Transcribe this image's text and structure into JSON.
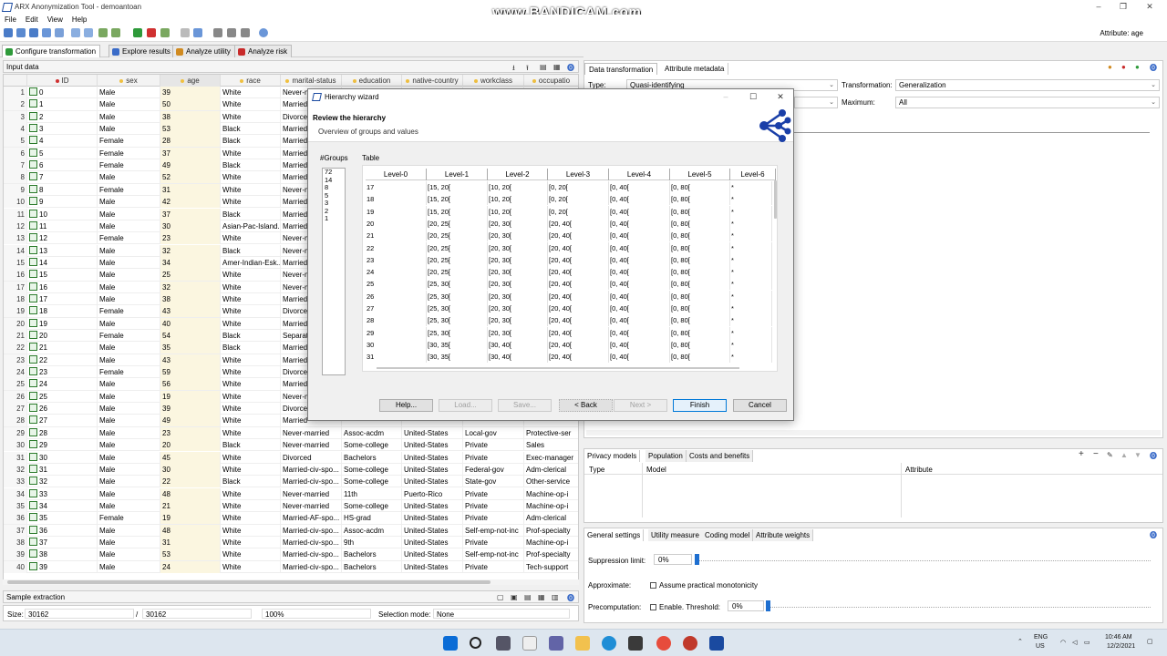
{
  "app": {
    "title": "ARX Anonymization Tool - demoantoan",
    "watermark": "www.BANDICAM.com",
    "attribute_label": "Attribute: age"
  },
  "menu": [
    "File",
    "Edit",
    "View",
    "Help"
  ],
  "perspectives": [
    {
      "label": "Configure transformation",
      "color": "#2e9a3a"
    },
    {
      "label": "Explore results",
      "color": "#3a6bc8"
    },
    {
      "label": "Analyze utility",
      "color": "#d08a20"
    },
    {
      "label": "Analyze risk",
      "color": "#c82a2a"
    }
  ],
  "input": {
    "title": "Input data",
    "columns": [
      "ID",
      "sex",
      "age",
      "race",
      "marital-status",
      "education",
      "native-country",
      "workclass",
      "occupatio"
    ],
    "rows": [
      [
        "0",
        "Male",
        "39",
        "White",
        "Never-m",
        "",
        "",
        "",
        ""
      ],
      [
        "1",
        "Male",
        "50",
        "White",
        "Married",
        "",
        "",
        "",
        ""
      ],
      [
        "2",
        "Male",
        "38",
        "White",
        "Divorce",
        "",
        "",
        "",
        ""
      ],
      [
        "3",
        "Male",
        "53",
        "Black",
        "Married",
        "",
        "",
        "",
        ""
      ],
      [
        "4",
        "Female",
        "28",
        "Black",
        "Married",
        "",
        "",
        "",
        ""
      ],
      [
        "5",
        "Female",
        "37",
        "White",
        "Married",
        "",
        "",
        "",
        ""
      ],
      [
        "6",
        "Female",
        "49",
        "Black",
        "Married",
        "",
        "",
        "",
        ""
      ],
      [
        "7",
        "Male",
        "52",
        "White",
        "Married",
        "",
        "",
        "",
        ""
      ],
      [
        "8",
        "Female",
        "31",
        "White",
        "Never-m",
        "",
        "",
        "",
        ""
      ],
      [
        "9",
        "Male",
        "42",
        "White",
        "Married",
        "",
        "",
        "",
        ""
      ],
      [
        "10",
        "Male",
        "37",
        "Black",
        "Married",
        "",
        "",
        "",
        ""
      ],
      [
        "11",
        "Male",
        "30",
        "Asian-Pac-Island...",
        "Married",
        "",
        "",
        "",
        ""
      ],
      [
        "12",
        "Female",
        "23",
        "White",
        "Never-m",
        "",
        "",
        "",
        ""
      ],
      [
        "13",
        "Male",
        "32",
        "Black",
        "Never-m",
        "",
        "",
        "",
        ""
      ],
      [
        "14",
        "Male",
        "34",
        "Amer-Indian-Esk...",
        "Married",
        "",
        "",
        "",
        ""
      ],
      [
        "15",
        "Male",
        "25",
        "White",
        "Never-m",
        "",
        "",
        "",
        ""
      ],
      [
        "16",
        "Male",
        "32",
        "White",
        "Never-m",
        "",
        "",
        "",
        ""
      ],
      [
        "17",
        "Male",
        "38",
        "White",
        "Married",
        "",
        "",
        "",
        ""
      ],
      [
        "18",
        "Female",
        "43",
        "White",
        "Divorce",
        "",
        "",
        "",
        ""
      ],
      [
        "19",
        "Male",
        "40",
        "White",
        "Married",
        "",
        "",
        "",
        ""
      ],
      [
        "20",
        "Female",
        "54",
        "Black",
        "Separat",
        "",
        "",
        "",
        ""
      ],
      [
        "21",
        "Male",
        "35",
        "Black",
        "Married",
        "",
        "",
        "",
        ""
      ],
      [
        "22",
        "Male",
        "43",
        "White",
        "Married",
        "",
        "",
        "",
        ""
      ],
      [
        "23",
        "Female",
        "59",
        "White",
        "Divorce",
        "",
        "",
        "",
        ""
      ],
      [
        "24",
        "Male",
        "56",
        "White",
        "Married",
        "",
        "",
        "",
        ""
      ],
      [
        "25",
        "Male",
        "19",
        "White",
        "Never-m",
        "",
        "",
        "",
        ""
      ],
      [
        "26",
        "Male",
        "39",
        "White",
        "Divorce",
        "",
        "",
        "",
        ""
      ],
      [
        "27",
        "Male",
        "49",
        "White",
        "Married",
        "",
        "",
        "",
        ""
      ],
      [
        "28",
        "Male",
        "23",
        "White",
        "Never-married",
        "Assoc-acdm",
        "United-States",
        "Local-gov",
        "Protective-ser"
      ],
      [
        "29",
        "Male",
        "20",
        "Black",
        "Never-married",
        "Some-college",
        "United-States",
        "Private",
        "Sales"
      ],
      [
        "30",
        "Male",
        "45",
        "White",
        "Divorced",
        "Bachelors",
        "United-States",
        "Private",
        "Exec-manager"
      ],
      [
        "31",
        "Male",
        "30",
        "White",
        "Married-civ-spo...",
        "Some-college",
        "United-States",
        "Federal-gov",
        "Adm-clerical"
      ],
      [
        "32",
        "Male",
        "22",
        "Black",
        "Married-civ-spo...",
        "Some-college",
        "United-States",
        "State-gov",
        "Other-service"
      ],
      [
        "33",
        "Male",
        "48",
        "White",
        "Never-married",
        "11th",
        "Puerto-Rico",
        "Private",
        "Machine-op-i"
      ],
      [
        "34",
        "Male",
        "21",
        "White",
        "Never-married",
        "Some-college",
        "United-States",
        "Private",
        "Machine-op-i"
      ],
      [
        "35",
        "Female",
        "19",
        "White",
        "Married-AF-spo...",
        "HS-grad",
        "United-States",
        "Private",
        "Adm-clerical"
      ],
      [
        "36",
        "Male",
        "48",
        "White",
        "Married-civ-spo...",
        "Assoc-acdm",
        "United-States",
        "Self-emp-not-inc",
        "Prof-specialty"
      ],
      [
        "37",
        "Male",
        "31",
        "White",
        "Married-civ-spo...",
        "9th",
        "United-States",
        "Private",
        "Machine-op-i"
      ],
      [
        "38",
        "Male",
        "53",
        "White",
        "Married-civ-spo...",
        "Bachelors",
        "United-States",
        "Self-emp-not-inc",
        "Prof-specialty"
      ],
      [
        "39",
        "Male",
        "24",
        "White",
        "Married-civ-spo...",
        "Bachelors",
        "United-States",
        "Private",
        "Tech-support"
      ]
    ]
  },
  "sample": {
    "title": "Sample extraction"
  },
  "status": {
    "size_label": "Size:",
    "size": "30162",
    "slash": "/",
    "total": "30162",
    "percent": "100%",
    "selection_label": "Selection mode:",
    "selection": "None"
  },
  "right": {
    "tabs": [
      "Data transformation",
      "Attribute metadata"
    ],
    "type_label": "Type:",
    "type_value": "Quasi-identifying",
    "transformation_label": "Transformation:",
    "transformation_value": "Generalization",
    "maximum_label": "Maximum:",
    "maximum_value": "All"
  },
  "privacy": {
    "tabs": [
      "Privacy models",
      "Population",
      "Costs and benefits"
    ],
    "cols": [
      "Type",
      "Model",
      "Attribute"
    ]
  },
  "general": {
    "tabs": [
      "General settings",
      "Utility measure",
      "Coding model",
      "Attribute weights"
    ],
    "suppression_label": "Suppression limit:",
    "suppression_value": "0%",
    "approximate_label": "Approximate:",
    "monotonicity_label": "Assume practical monotonicity",
    "precomputation_label": "Precomputation:",
    "enable_label": "Enable. Threshold:",
    "threshold_value": "0%"
  },
  "dialog": {
    "title": "Hierarchy wizard",
    "heading": "Review the hierarchy",
    "subheading": "Overview of groups and values",
    "groups_label": "#Groups",
    "table_label": "Table",
    "groups": [
      "72",
      "14",
      "8",
      "5",
      "3",
      "2",
      "1"
    ],
    "levels": [
      "Level-0",
      "Level-1",
      "Level-2",
      "Level-3",
      "Level-4",
      "Level-5",
      "Level-6"
    ],
    "rows": [
      [
        "17",
        "[15, 20[",
        "[10, 20[",
        "[0, 20[",
        "[0, 40[",
        "[0, 80[",
        "*"
      ],
      [
        "18",
        "[15, 20[",
        "[10, 20[",
        "[0, 20[",
        "[0, 40[",
        "[0, 80[",
        "*"
      ],
      [
        "19",
        "[15, 20[",
        "[10, 20[",
        "[0, 20[",
        "[0, 40[",
        "[0, 80[",
        "*"
      ],
      [
        "20",
        "[20, 25[",
        "[20, 30[",
        "[20, 40[",
        "[0, 40[",
        "[0, 80[",
        "*"
      ],
      [
        "21",
        "[20, 25[",
        "[20, 30[",
        "[20, 40[",
        "[0, 40[",
        "[0, 80[",
        "*"
      ],
      [
        "22",
        "[20, 25[",
        "[20, 30[",
        "[20, 40[",
        "[0, 40[",
        "[0, 80[",
        "*"
      ],
      [
        "23",
        "[20, 25[",
        "[20, 30[",
        "[20, 40[",
        "[0, 40[",
        "[0, 80[",
        "*"
      ],
      [
        "24",
        "[20, 25[",
        "[20, 30[",
        "[20, 40[",
        "[0, 40[",
        "[0, 80[",
        "*"
      ],
      [
        "25",
        "[25, 30[",
        "[20, 30[",
        "[20, 40[",
        "[0, 40[",
        "[0, 80[",
        "*"
      ],
      [
        "26",
        "[25, 30[",
        "[20, 30[",
        "[20, 40[",
        "[0, 40[",
        "[0, 80[",
        "*"
      ],
      [
        "27",
        "[25, 30[",
        "[20, 30[",
        "[20, 40[",
        "[0, 40[",
        "[0, 80[",
        "*"
      ],
      [
        "28",
        "[25, 30[",
        "[20, 30[",
        "[20, 40[",
        "[0, 40[",
        "[0, 80[",
        "*"
      ],
      [
        "29",
        "[25, 30[",
        "[20, 30[",
        "[20, 40[",
        "[0, 40[",
        "[0, 80[",
        "*"
      ],
      [
        "30",
        "[30, 35[",
        "[30, 40[",
        "[20, 40[",
        "[0, 40[",
        "[0, 80[",
        "*"
      ],
      [
        "31",
        "[30, 35[",
        "[30, 40[",
        "[20, 40[",
        "[0, 40[",
        "[0, 80[",
        "*"
      ]
    ],
    "buttons": {
      "help": "Help...",
      "load": "Load...",
      "save": "Save...",
      "back": "< Back",
      "next": "Next >",
      "finish": "Finish",
      "cancel": "Cancel"
    }
  },
  "taskbar": {
    "lang": "ENG",
    "region": "US",
    "time": "10:46 AM",
    "date": "12/2/2021"
  }
}
